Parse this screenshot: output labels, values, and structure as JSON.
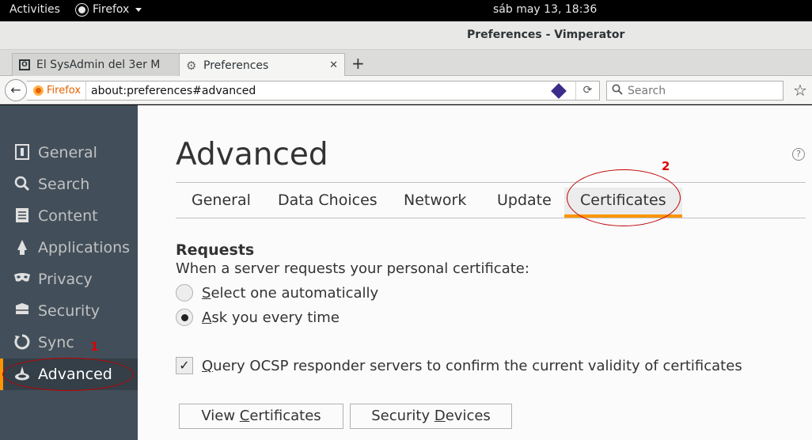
{
  "topbar": {
    "activities": "Activities",
    "app": "Firefox",
    "clock": "sáb may 13, 18:36"
  },
  "window": {
    "title": "Preferences - Vimperator"
  },
  "tabs": [
    {
      "label": "El SysAdmin del 3er M",
      "favicon": "page-favicon-icon"
    },
    {
      "label": "Preferences",
      "favicon": "gear-icon"
    }
  ],
  "navbar": {
    "identity": "Firefox",
    "url": "about:preferences#advanced",
    "search_placeholder": "Search"
  },
  "sidebar": {
    "items": [
      {
        "label": "General",
        "icon": "general-icon"
      },
      {
        "label": "Search",
        "icon": "search-icon"
      },
      {
        "label": "Content",
        "icon": "content-icon"
      },
      {
        "label": "Applications",
        "icon": "applications-icon"
      },
      {
        "label": "Privacy",
        "icon": "privacy-mask-icon"
      },
      {
        "label": "Security",
        "icon": "security-icon"
      },
      {
        "label": "Sync",
        "icon": "sync-icon"
      },
      {
        "label": "Advanced",
        "icon": "advanced-wizard-icon",
        "selected": true
      }
    ]
  },
  "main": {
    "title": "Advanced",
    "tabs": [
      "General",
      "Data Choices",
      "Network",
      "Update",
      "Certificates"
    ],
    "selected_tab": "Certificates",
    "requests_heading": "Requests",
    "requests_desc": "When a server requests your personal certificate:",
    "radio": [
      {
        "label_u": "S",
        "label_rest": "elect one automatically",
        "checked": false
      },
      {
        "label_u": "A",
        "label_rest": "sk you every time",
        "checked": true
      }
    ],
    "ocsp": {
      "label_u": "Q",
      "label_rest": "uery OCSP responder servers to confirm the current validity of certificates",
      "checked": true
    },
    "buttons": {
      "view_pre": "View ",
      "view_u": "C",
      "view_rest": "ertificates",
      "devices_pre": "Security ",
      "devices_u": "D",
      "devices_rest": "evices"
    }
  },
  "annotations": {
    "one": "1",
    "two": "2",
    "color": "#e00000"
  },
  "colors": {
    "accent": "#ff9500",
    "sidebar": "#424f5a"
  }
}
